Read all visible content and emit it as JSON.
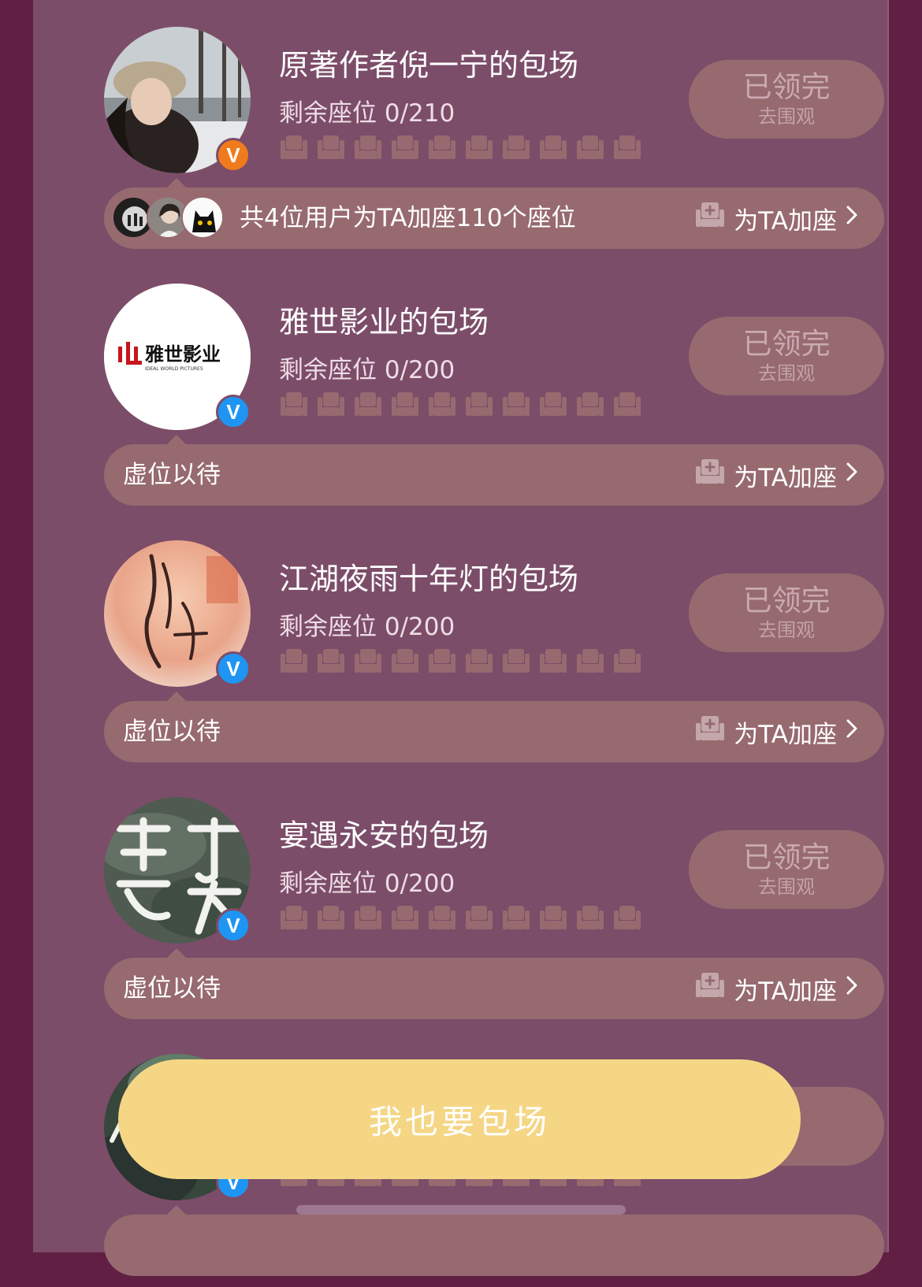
{
  "sessions": [
    {
      "title": "原著作者倪一宁的包场",
      "seats_label": "剩余座位 0/210",
      "button_main": "已领完",
      "button_sub": "去围观",
      "strip_text": "共4位用户为TA加座110个座位",
      "add_seat_label": "为TA加座",
      "badge_color": "#f07b1c"
    },
    {
      "title": "雅世影业的包场",
      "seats_label": "剩余座位 0/200",
      "button_main": "已领完",
      "button_sub": "去围观",
      "strip_text": "虚位以待",
      "add_seat_label": "为TA加座",
      "avatar_logo_text": "雅世影业",
      "avatar_logo_sub": "IDEAL WORLD PICTURES",
      "badge_color": "#1e95f3"
    },
    {
      "title": "江湖夜雨十年灯的包场",
      "seats_label": "剩余座位 0/200",
      "button_main": "已领完",
      "button_sub": "去围观",
      "strip_text": "虚位以待",
      "add_seat_label": "为TA加座",
      "badge_color": "#1e95f3"
    },
    {
      "title": "宴遇永安的包场",
      "seats_label": "剩余座位 0/200",
      "button_main": "已领完",
      "button_sub": "去围观",
      "strip_text": "虚位以待",
      "add_seat_label": "为TA加座",
      "badge_color": "#1e95f3"
    }
  ],
  "cta": {
    "label": "我也要包场"
  },
  "colors": {
    "background": "#611f44",
    "panel": "#7c4d69",
    "button": "#976a6f",
    "cta": "#f5d685"
  }
}
